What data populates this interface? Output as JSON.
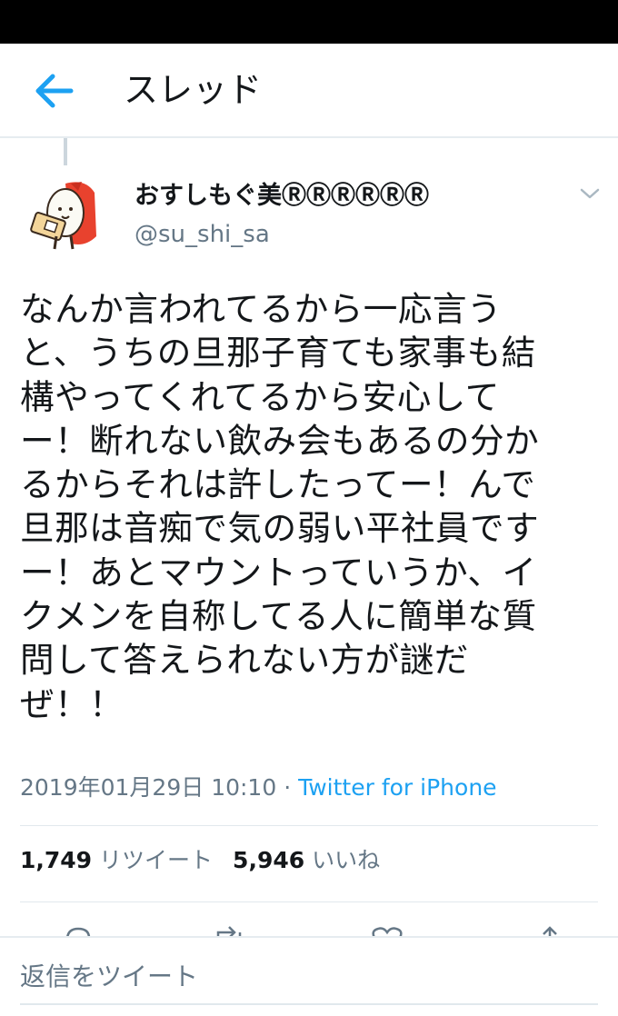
{
  "header": {
    "title": "スレッド",
    "back_icon": "back-arrow-icon"
  },
  "tweet": {
    "display_name": "おすしもぐ美ⓇⓇⓇⓇⓇⓇ",
    "screen_name": "@su_shi_sa",
    "text": "なんか言われてるから一応言う\nと、うちの旦那子育ても家事も結\n構やってくれてるから安心して\nー！断れない飲み会もあるの分か\nるからそれは許したってー！んで\n旦那は音痴で気の弱い平社員です\nー！あとマウントっていうか、イ\nクメンを自称してる人に簡単な質\n問して答えられない方が謎だ\nぜ！！",
    "timestamp": "2019年01月29日 10:10",
    "separator": " · ",
    "source": "Twitter for iPhone",
    "retweet_count": "1,749",
    "retweet_label": "リツイート",
    "like_count": "5,946",
    "like_label": "いいね"
  },
  "reply": {
    "placeholder": "返信をツイート"
  },
  "colors": {
    "accent": "#1da1f2",
    "text": "#14171a",
    "secondary": "#657786",
    "divider": "#e1e8ed"
  }
}
